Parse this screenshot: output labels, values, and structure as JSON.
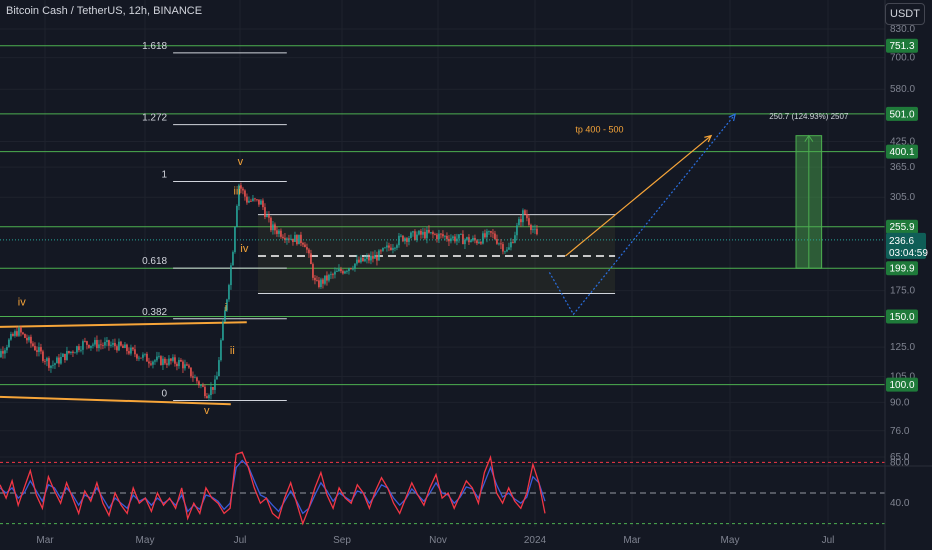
{
  "header": {
    "title": "Bitcoin Cash / TetherUS, 12h, BINANCE",
    "currency": "USDT"
  },
  "colors": {
    "bg": "#141823",
    "grid": "#1e222d",
    "green": "#4caf50",
    "red": "#f23645",
    "orange": "#f7a539",
    "blue": "#2962ff",
    "white": "#d1d4dc",
    "label": "#7f8390"
  },
  "chart_data": [
    {
      "type": "candlestick",
      "y_scale": "log",
      "y_ticks": [
        "830.0",
        "700.0",
        "580.0",
        "425.0",
        "365.0",
        "305.0",
        "175.0",
        "125.0",
        "105.0",
        "90.0",
        "76.0",
        "65.0"
      ],
      "x_ticks": [
        "Mar",
        "May",
        "Jul",
        "Sep",
        "Nov",
        "2024",
        "Mar",
        "May",
        "Jul"
      ],
      "price_levels": [
        "751.3",
        "501.0",
        "400.1",
        "255.9",
        "199.9",
        "150.0",
        "100.0"
      ],
      "current_price": "236.6",
      "countdown": "03:04:59",
      "fib_levels": [
        {
          "ratio": "1.618",
          "price": 720
        },
        {
          "ratio": "1.272",
          "price": 470
        },
        {
          "ratio": "1",
          "price": 335
        },
        {
          "ratio": "0.618",
          "price": 200
        },
        {
          "ratio": "0.382",
          "price": 148
        },
        {
          "ratio": "0",
          "price": 91
        }
      ],
      "wave_labels": [
        "iv",
        "v",
        "i",
        "ii",
        "iii",
        "iv",
        "v"
      ],
      "annotations": {
        "target": "tp 400 - 500",
        "measure": "250.7 (124.93%) 2507"
      },
      "range_box": {
        "top": 275,
        "mid": 215,
        "bottom": 172
      },
      "price_path": [
        {
          "t": "2023-01-25",
          "p": 110
        },
        {
          "t": "2023-02-12",
          "p": 138
        },
        {
          "t": "2023-03-05",
          "p": 112
        },
        {
          "t": "2023-03-25",
          "p": 128
        },
        {
          "t": "2023-04-15",
          "p": 126
        },
        {
          "t": "2023-05-05",
          "p": 116
        },
        {
          "t": "2023-05-25",
          "p": 114
        },
        {
          "t": "2023-06-10",
          "p": 95
        },
        {
          "t": "2023-06-16",
          "p": 101
        },
        {
          "t": "2023-06-22",
          "p": 160
        },
        {
          "t": "2023-06-26",
          "p": 215
        },
        {
          "t": "2023-06-29",
          "p": 300
        },
        {
          "t": "2023-06-30",
          "p": 330
        },
        {
          "t": "2023-07-05",
          "p": 300
        },
        {
          "t": "2023-07-14",
          "p": 295
        },
        {
          "t": "2023-07-20",
          "p": 255
        },
        {
          "t": "2023-08-01",
          "p": 240
        },
        {
          "t": "2023-08-10",
          "p": 235
        },
        {
          "t": "2023-08-17",
          "p": 180
        },
        {
          "t": "2023-08-26",
          "p": 190
        },
        {
          "t": "2023-09-10",
          "p": 205
        },
        {
          "t": "2023-09-25",
          "p": 215
        },
        {
          "t": "2023-10-10",
          "p": 240
        },
        {
          "t": "2023-10-25",
          "p": 245
        },
        {
          "t": "2023-11-10",
          "p": 240
        },
        {
          "t": "2023-11-25",
          "p": 235
        },
        {
          "t": "2023-12-05",
          "p": 245
        },
        {
          "t": "2023-12-15",
          "p": 220
        },
        {
          "t": "2023-12-25",
          "p": 280
        },
        {
          "t": "2024-01-03",
          "p": 236.6
        }
      ],
      "projections": [
        {
          "name": "orange",
          "points": [
            {
              "t": "2024-01-20",
              "p": 215
            },
            {
              "t": "2024-04-20",
              "p": 440
            }
          ]
        },
        {
          "name": "blue",
          "points": [
            {
              "t": "2024-01-10",
              "p": 195
            },
            {
              "t": "2024-01-25",
              "p": 152
            },
            {
              "t": "2024-05-05",
              "p": 500
            }
          ]
        }
      ]
    },
    {
      "type": "line",
      "indicator": "rsi",
      "y_ticks": [
        "80.0",
        "40.0"
      ],
      "ylim": [
        5,
        95
      ],
      "bands": [
        80,
        50,
        20
      ],
      "series": [
        {
          "name": "red",
          "values": [
            58,
            45,
            62,
            38,
            55,
            72,
            48,
            35,
            66,
            52,
            40,
            60,
            45,
            30,
            52,
            42,
            60,
            40,
            28,
            50,
            38,
            30,
            55,
            40,
            45,
            32,
            50,
            38,
            45,
            35,
            55,
            25,
            40,
            30,
            55,
            45,
            40,
            30,
            35,
            88,
            90,
            75,
            55,
            40,
            45,
            30,
            25,
            45,
            60,
            40,
            20,
            35,
            55,
            70,
            48,
            35,
            55,
            45,
            40,
            58,
            50,
            35,
            52,
            65,
            55,
            40,
            30,
            45,
            60,
            48,
            38,
            55,
            68,
            45,
            50,
            35,
            48,
            62,
            55,
            40,
            70,
            85,
            50,
            40,
            55,
            42,
            35,
            50,
            78,
            60,
            30
          ]
        },
        {
          "name": "blue",
          "values": [
            55,
            50,
            55,
            45,
            50,
            62,
            52,
            42,
            58,
            55,
            45,
            55,
            48,
            38,
            48,
            45,
            55,
            45,
            35,
            45,
            40,
            35,
            48,
            42,
            45,
            38,
            45,
            40,
            44,
            38,
            48,
            32,
            38,
            34,
            48,
            46,
            42,
            34,
            40,
            75,
            82,
            76,
            62,
            48,
            45,
            38,
            32,
            42,
            52,
            42,
            30,
            35,
            48,
            60,
            52,
            42,
            50,
            46,
            42,
            52,
            50,
            40,
            48,
            58,
            55,
            45,
            38,
            44,
            54,
            48,
            42,
            50,
            60,
            50,
            48,
            40,
            46,
            56,
            54,
            45,
            60,
            75,
            58,
            46,
            50,
            44,
            40,
            46,
            66,
            60,
            42
          ]
        }
      ]
    }
  ]
}
